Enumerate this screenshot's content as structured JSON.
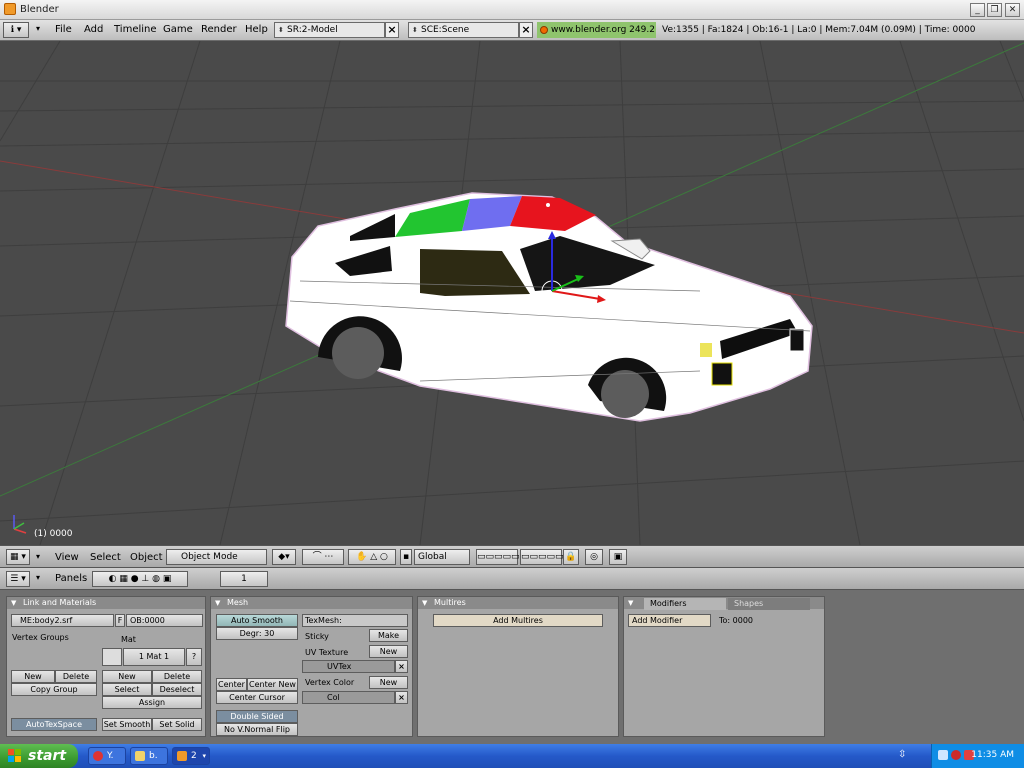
{
  "window": {
    "title": "Blender",
    "min": "_",
    "max": "❐",
    "close": "✕"
  },
  "menu": [
    "File",
    "Add",
    "Timeline",
    "Game",
    "Render",
    "Help"
  ],
  "screen_field": "SR:2-Model",
  "scene_field": "SCE:Scene",
  "url": "www.blender.org 249.2",
  "stats": "Ve:1355 | Fa:1824 | Ob:16-1 | La:0 | Mem:7.04M (0.09M) | Time: 0000",
  "viewport": {
    "frame_label": "(1) 0000",
    "background": "#4a4a4a"
  },
  "view3d_header": {
    "menus": [
      "View",
      "Select",
      "Object"
    ],
    "mode": "Object Mode",
    "orientation": "Global"
  },
  "buttons_header": {
    "panels_label": "Panels",
    "frame_value": "1"
  },
  "panels": {
    "link_materials": {
      "title": "Link and Materials",
      "mesh_name": "ME:body2.srf",
      "f_flag": "F",
      "object_name": "OB:0000",
      "vertex_groups_label": "Vertex Groups",
      "mat_label": "Mat",
      "mat_value": "1 Mat 1",
      "mat_help": "?",
      "vg_new": "New",
      "vg_delete": "Delete",
      "copy_group": "Copy Group",
      "mat_new": "New",
      "mat_delete": "Delete",
      "mat_select": "Select",
      "mat_deselect": "Deselect",
      "assign": "Assign",
      "autotexspace": "AutoTexSpace",
      "set_smooth": "Set Smooth",
      "set_solid": "Set Solid"
    },
    "mesh": {
      "title": "Mesh",
      "auto_smooth": "Auto Smooth",
      "degr": "Degr: 30",
      "texmesh": "TexMesh:",
      "sticky": "Sticky",
      "make": "Make",
      "uv_texture": "UV Texture",
      "uv_new": "New",
      "uvtex": "UVTex",
      "vertex_color": "Vertex Color",
      "vc_new": "New",
      "col": "Col",
      "center": "Center",
      "center_new": "Center New",
      "center_cursor": "Center Cursor",
      "double_sided": "Double Sided",
      "no_vnormal_flip": "No V.Normal Flip"
    },
    "multires": {
      "title": "Multires",
      "add_multires": "Add Multires"
    },
    "modifiers": {
      "tab_modifiers": "Modifiers",
      "tab_shapes": "Shapes",
      "add_modifier": "Add Modifier",
      "to": "To: 0000"
    }
  },
  "taskbar": {
    "start": "start",
    "tasks": [
      "Y.",
      "b.",
      "2"
    ],
    "clock": "11:35 AM"
  }
}
